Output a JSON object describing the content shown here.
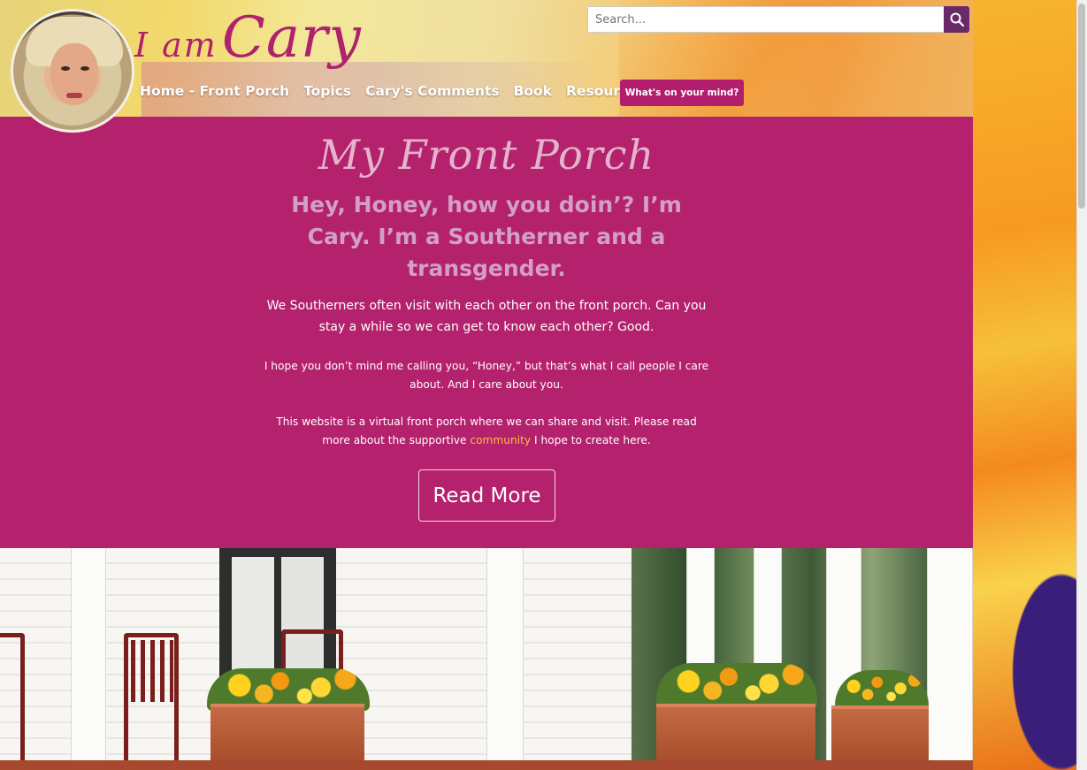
{
  "header": {
    "logo_small": "I am",
    "logo_big": "Cary",
    "search_placeholder": "Search...",
    "cta_label": "What's on your mind?"
  },
  "nav": {
    "items": [
      "Home - Front Porch",
      "Topics",
      "Cary's Comments",
      "Book",
      "Resources"
    ]
  },
  "hero": {
    "script_title": "My Front Porch",
    "headline": "Hey, Honey, how you doin’? I’m Cary. I’m a Southerner and a transgender.",
    "intro": "We Southerners often visit with each other on the front porch. Can you stay a while so we can get to know each other? Good.",
    "para1": "I hope you don’t mind me calling you, “Honey,” but that’s what I call people I care about. And I care about you.",
    "para2_before": "This website is a virtual front porch where we can share and visit. Please read more about the supportive ",
    "para2_link": "community",
    "para2_after": " I hope to create here.",
    "read_more_label": "Read More"
  },
  "colors": {
    "brand_magenta": "#b4216d",
    "cta_magenta": "#b21e6d",
    "search_button": "#6a2a6a",
    "link_gold": "#f4c13c",
    "headline_pink": "#d3a0c5"
  },
  "icons": {
    "search": "search-icon",
    "avatar": "avatar"
  }
}
